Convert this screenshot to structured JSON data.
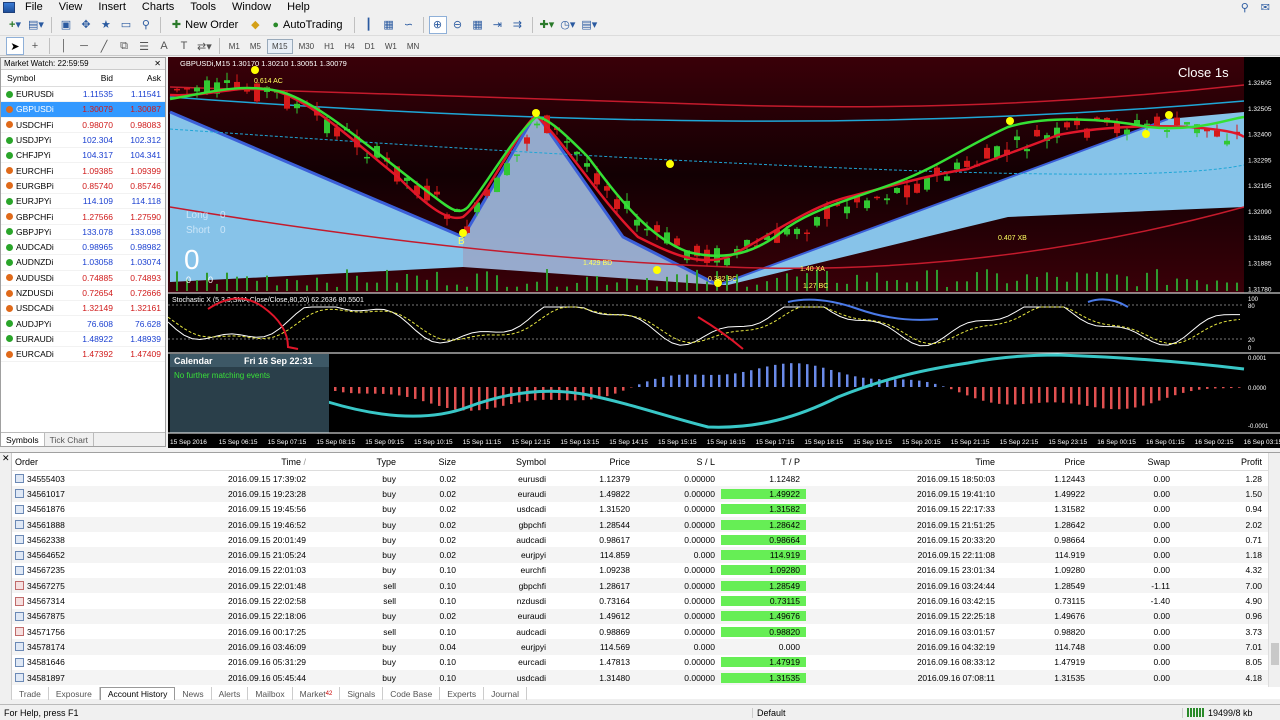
{
  "menu": [
    "File",
    "View",
    "Insert",
    "Charts",
    "Tools",
    "Window",
    "Help"
  ],
  "toolbar": {
    "new_order": "New Order",
    "auto_trading": "AutoTrading",
    "timeframes": [
      "M1",
      "M5",
      "M15",
      "M30",
      "H1",
      "H4",
      "D1",
      "W1",
      "MN"
    ],
    "active_timeframe": "M15"
  },
  "market_watch": {
    "title": "Market Watch: 22:59:59",
    "columns": [
      "Symbol",
      "Bid",
      "Ask"
    ],
    "rows": [
      {
        "symbol": "EURUSDi",
        "bid": "1.11535",
        "ask": "1.11541",
        "dir": "up"
      },
      {
        "symbol": "GBPUSDi",
        "bid": "1.30079",
        "ask": "1.30087",
        "dir": "down"
      },
      {
        "symbol": "USDCHFi",
        "bid": "0.98070",
        "ask": "0.98083",
        "dir": "down"
      },
      {
        "symbol": "USDJPYi",
        "bid": "102.304",
        "ask": "102.312",
        "dir": "up"
      },
      {
        "symbol": "CHFJPYi",
        "bid": "104.317",
        "ask": "104.341",
        "dir": "up"
      },
      {
        "symbol": "EURCHFi",
        "bid": "1.09385",
        "ask": "1.09399",
        "dir": "down"
      },
      {
        "symbol": "EURGBPi",
        "bid": "0.85740",
        "ask": "0.85746",
        "dir": "down"
      },
      {
        "symbol": "EURJPYi",
        "bid": "114.109",
        "ask": "114.118",
        "dir": "up"
      },
      {
        "symbol": "GBPCHFi",
        "bid": "1.27566",
        "ask": "1.27590",
        "dir": "down"
      },
      {
        "symbol": "GBPJPYi",
        "bid": "133.078",
        "ask": "133.098",
        "dir": "up"
      },
      {
        "symbol": "AUDCADi",
        "bid": "0.98965",
        "ask": "0.98982",
        "dir": "up"
      },
      {
        "symbol": "AUDNZDi",
        "bid": "1.03058",
        "ask": "1.03074",
        "dir": "up"
      },
      {
        "symbol": "AUDUSDi",
        "bid": "0.74885",
        "ask": "0.74893",
        "dir": "down"
      },
      {
        "symbol": "NZDUSDi",
        "bid": "0.72654",
        "ask": "0.72666",
        "dir": "down"
      },
      {
        "symbol": "USDCADi",
        "bid": "1.32149",
        "ask": "1.32161",
        "dir": "down"
      },
      {
        "symbol": "AUDJPYi",
        "bid": "76.608",
        "ask": "76.628",
        "dir": "up"
      },
      {
        "symbol": "EURAUDi",
        "bid": "1.48922",
        "ask": "1.48939",
        "dir": "up"
      },
      {
        "symbol": "EURCADi",
        "bid": "1.47392",
        "ask": "1.47409",
        "dir": "down"
      }
    ],
    "selected": 1,
    "tabs": [
      "Symbols",
      "Tick Chart"
    ]
  },
  "chart": {
    "header": "GBPUSDi,M15  1.30170 1.30210 1.30051 1.30079",
    "close_timer": "Close 1s",
    "long_label": "Long",
    "long_value": "0",
    "short_label": "Short",
    "short_value": "0",
    "big_zero": "0",
    "small_zero_left": "0",
    "small_zero_right": "0",
    "pattern_labels": {
      "label_ac": "0.614 AC",
      "label_b": "B",
      "label_bd": "1.429 BD",
      "label_xb": "0.407 XB",
      "label_xa": "1.40 XA",
      "label_bc": "1.27 BC",
      "label_bc2": "0.382 BC"
    },
    "price_axis": [
      "1.32605",
      "1.32505",
      "1.32400",
      "1.32295",
      "1.32195",
      "1.32090",
      "1.31985",
      "1.31885",
      "1.31780"
    ],
    "stochastic": {
      "title": "Stochastic X (5,3,3,SMA,Close/Close,80,20) 62.2636 80.5501",
      "levels": [
        "100",
        "80",
        "20",
        "0"
      ]
    },
    "calendar": {
      "title": "Calendar",
      "datetime": "Fri 16 Sep 22:31",
      "message": "No further matching events"
    },
    "osc_levels": [
      "0.0001",
      "0.0000",
      "-0.0001"
    ],
    "time_axis": [
      "15 Sep 2016",
      "15 Sep 06:15",
      "15 Sep 07:15",
      "15 Sep 08:15",
      "15 Sep 09:15",
      "15 Sep 10:15",
      "15 Sep 11:15",
      "15 Sep 12:15",
      "15 Sep 13:15",
      "15 Sep 14:15",
      "15 Sep 15:15",
      "15 Sep 16:15",
      "15 Sep 17:15",
      "15 Sep 18:15",
      "15 Sep 19:15",
      "15 Sep 20:15",
      "15 Sep 21:15",
      "15 Sep 22:15",
      "15 Sep 23:15",
      "16 Sep 00:15",
      "16 Sep 01:15",
      "16 Sep 02:15",
      "16 Sep 03:15"
    ]
  },
  "terminal": {
    "columns": [
      "Order",
      "Time",
      "Type",
      "Size",
      "Symbol",
      "Price",
      "S / L",
      "T / P",
      "Time",
      "Price",
      "Swap",
      "Profit"
    ],
    "rows": [
      {
        "order": "34555403",
        "open_time": "2016.09.15 17:39:02",
        "type": "buy",
        "size": "0.02",
        "symbol": "eurusdi",
        "price": "1.12379",
        "sl": "0.00000",
        "tp": "1.12482",
        "close_time": "2016.09.15 18:50:03",
        "close_price": "1.12443",
        "swap": "0.00",
        "profit": "1.28"
      },
      {
        "order": "34561017",
        "open_time": "2016.09.15 19:23:28",
        "type": "buy",
        "size": "0.02",
        "symbol": "euraudi",
        "price": "1.49822",
        "sl": "0.00000",
        "tp": "1.49922",
        "close_time": "2016.09.15 19:41:10",
        "close_price": "1.49922",
        "swap": "0.00",
        "profit": "1.50"
      },
      {
        "order": "34561876",
        "open_time": "2016.09.15 19:45:56",
        "type": "buy",
        "size": "0.02",
        "symbol": "usdcadi",
        "price": "1.31520",
        "sl": "0.00000",
        "tp": "1.31582",
        "close_time": "2016.09.15 22:17:33",
        "close_price": "1.31582",
        "swap": "0.00",
        "profit": "0.94"
      },
      {
        "order": "34561888",
        "open_time": "2016.09.15 19:46:52",
        "type": "buy",
        "size": "0.02",
        "symbol": "gbpchfi",
        "price": "1.28544",
        "sl": "0.00000",
        "tp": "1.28642",
        "close_time": "2016.09.15 21:51:25",
        "close_price": "1.28642",
        "swap": "0.00",
        "profit": "2.02"
      },
      {
        "order": "34562338",
        "open_time": "2016.09.15 20:01:49",
        "type": "buy",
        "size": "0.02",
        "symbol": "audcadi",
        "price": "0.98617",
        "sl": "0.00000",
        "tp": "0.98664",
        "close_time": "2016.09.15 20:33:20",
        "close_price": "0.98664",
        "swap": "0.00",
        "profit": "0.71"
      },
      {
        "order": "34564652",
        "open_time": "2016.09.15 21:05:24",
        "type": "buy",
        "size": "0.02",
        "symbol": "eurjpyi",
        "price": "114.859",
        "sl": "0.000",
        "tp": "114.919",
        "close_time": "2016.09.15 22:11:08",
        "close_price": "114.919",
        "swap": "0.00",
        "profit": "1.18"
      },
      {
        "order": "34567235",
        "open_time": "2016.09.15 22:01:03",
        "type": "buy",
        "size": "0.10",
        "symbol": "eurchfi",
        "price": "1.09238",
        "sl": "0.00000",
        "tp": "1.09280",
        "close_time": "2016.09.15 23:01:34",
        "close_price": "1.09280",
        "swap": "0.00",
        "profit": "4.32"
      },
      {
        "order": "34567275",
        "open_time": "2016.09.15 22:01:48",
        "type": "sell",
        "size": "0.10",
        "symbol": "gbpchfi",
        "price": "1.28617",
        "sl": "0.00000",
        "tp": "1.28549",
        "close_time": "2016.09.16 03:24:44",
        "close_price": "1.28549",
        "swap": "-1.11",
        "profit": "7.00"
      },
      {
        "order": "34567314",
        "open_time": "2016.09.15 22:02:58",
        "type": "sell",
        "size": "0.10",
        "symbol": "nzdusdi",
        "price": "0.73164",
        "sl": "0.00000",
        "tp": "0.73115",
        "close_time": "2016.09.16 03:42:15",
        "close_price": "0.73115",
        "swap": "-1.40",
        "profit": "4.90"
      },
      {
        "order": "34567875",
        "open_time": "2016.09.15 22:18:06",
        "type": "buy",
        "size": "0.02",
        "symbol": "euraudi",
        "price": "1.49612",
        "sl": "0.00000",
        "tp": "1.49676",
        "close_time": "2016.09.15 22:25:18",
        "close_price": "1.49676",
        "swap": "0.00",
        "profit": "0.96"
      },
      {
        "order": "34571756",
        "open_time": "2016.09.16 00:17:25",
        "type": "sell",
        "size": "0.10",
        "symbol": "audcadi",
        "price": "0.98869",
        "sl": "0.00000",
        "tp": "0.98820",
        "close_time": "2016.09.16 03:01:57",
        "close_price": "0.98820",
        "swap": "0.00",
        "profit": "3.73"
      },
      {
        "order": "34578174",
        "open_time": "2016.09.16 03:46:09",
        "type": "buy",
        "size": "0.04",
        "symbol": "eurjpyi",
        "price": "114.569",
        "sl": "0.000",
        "tp": "0.000",
        "close_time": "2016.09.16 04:32:19",
        "close_price": "114.748",
        "swap": "0.00",
        "profit": "7.01"
      },
      {
        "order": "34581646",
        "open_time": "2016.09.16 05:31:29",
        "type": "buy",
        "size": "0.10",
        "symbol": "eurcadi",
        "price": "1.47813",
        "sl": "0.00000",
        "tp": "1.47919",
        "close_time": "2016.09.16 08:33:12",
        "close_price": "1.47919",
        "swap": "0.00",
        "profit": "8.05"
      },
      {
        "order": "34581897",
        "open_time": "2016.09.16 05:45:44",
        "type": "buy",
        "size": "0.10",
        "symbol": "usdcadi",
        "price": "1.31480",
        "sl": "0.00000",
        "tp": "1.31535",
        "close_time": "2016.09.16 07:08:11",
        "close_price": "1.31535",
        "swap": "0.00",
        "profit": "4.18"
      }
    ],
    "tabs": [
      "Trade",
      "Exposure",
      "Account History",
      "News",
      "Alerts",
      "Mailbox",
      "Market",
      "Signals",
      "Code Base",
      "Experts",
      "Journal"
    ],
    "active_tab": "Account History",
    "market_badge": "42"
  },
  "status": {
    "help": "For Help, press F1",
    "profile": "Default",
    "traffic": "19499/8 kb"
  }
}
